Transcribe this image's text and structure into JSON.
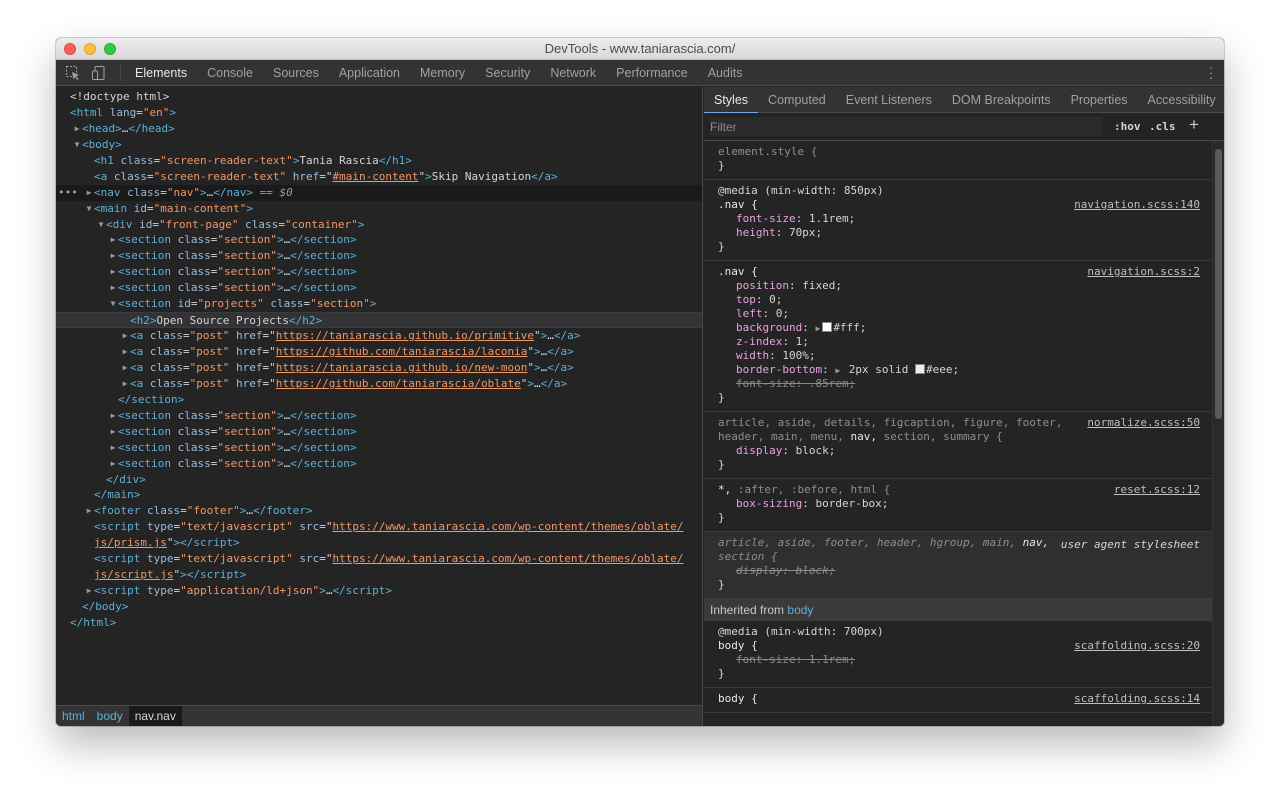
{
  "window": {
    "title": "DevTools - www.taniarascia.com/"
  },
  "toolbar": {
    "tabs": [
      "Elements",
      "Console",
      "Sources",
      "Application",
      "Memory",
      "Security",
      "Network",
      "Performance",
      "Audits"
    ],
    "active_tab": "Elements"
  },
  "dom": {
    "doctype": "<!doctype html>",
    "html_tag": "html",
    "lang_attr": "lang",
    "lang_val": "\"en\"",
    "head": "head",
    "body": "body",
    "h1_class": "\"screen-reader-text\"",
    "h1_text": "Tania Rascia",
    "a_class": "\"screen-reader-text\"",
    "a_href": "#main-content",
    "a_text": "Skip Navigation",
    "nav_class": "\"nav\"",
    "selected_suffix": " == $0",
    "main_id": "\"main-content\"",
    "div_id": "\"front-page\"",
    "div_class": "\"container\"",
    "section_class": "\"section\"",
    "projects_id": "\"projects\"",
    "h2_text": "Open Source Projects",
    "post_class": "\"post\"",
    "links": [
      "https://taniarascia.github.io/primitive",
      "https://github.com/taniarascia/laconia",
      "https://taniarascia.github.io/new-moon",
      "https://github.com/taniarascia/oblate"
    ],
    "footer_class": "\"footer\"",
    "script_type": "\"text/javascript\"",
    "script1_src_a": "https://www.taniarascia.com/wp-content/themes/oblate/",
    "script1_src_b": "js/prism.js",
    "script2_src_a": "https://www.taniarascia.com/wp-content/themes/oblate/",
    "script2_src_b": "js/script.js",
    "ldjson_type": "\"application/ld+json\"",
    "ellipsis": "…"
  },
  "breadcrumbs": [
    "html",
    "body",
    "nav.nav"
  ],
  "styles_panel": {
    "tabs": [
      "Styles",
      "Computed",
      "Event Listeners",
      "DOM Breakpoints",
      "Properties",
      "Accessibility"
    ],
    "active_tab": "Styles",
    "filter_placeholder": "Filter",
    "hov_label": ":hov",
    "cls_label": ".cls",
    "add_label": "+",
    "inherited_label": "Inherited from",
    "inherited_from": "body"
  },
  "rules": {
    "element_style": "element.style {",
    "r1_media": "@media (min-width: 850px)",
    "r1_selector": ".nav {",
    "r1_source": "navigation.scss:140",
    "r1_p1_name": "font-size",
    "r1_p1_val": "1.1rem;",
    "r1_p2_name": "height",
    "r1_p2_val": "70px;",
    "r2_selector": ".nav {",
    "r2_source": "navigation.scss:2",
    "r2_p1_name": "position",
    "r2_p1_val": "fixed;",
    "r2_p2_name": "top",
    "r2_p2_val": "0;",
    "r2_p3_name": "left",
    "r2_p3_val": "0;",
    "r2_p4_name": "background",
    "r2_p4_val": "#fff;",
    "r2_p5_name": "z-index",
    "r2_p5_val": "1;",
    "r2_p6_name": "width",
    "r2_p6_val": "100%;",
    "r2_p7_name": "border-bottom",
    "r2_p7_val_a": "2px solid",
    "r2_p7_val_b": "#eee;",
    "r2_p8": "font-size: .85rem;",
    "r3_sel_a": "article, aside, details, figcaption, figure, footer,",
    "r3_sel_b1": "header, main, menu, ",
    "r3_sel_b2": "nav,",
    "r3_sel_b3": " section, summary {",
    "r3_source": "normalize.scss:50",
    "r3_p1_name": "display",
    "r3_p1_val": "block;",
    "r4_sel_a": "*,",
    "r4_sel_b": " :after, :before, html {",
    "r4_source": "reset.scss:12",
    "r4_p1_name": "box-sizing",
    "r4_p1_val": "border-box;",
    "r5_sel_a": "article, aside, footer, header, hgroup, main, ",
    "r5_sel_b": "nav,",
    "r5_sel_c": "section {",
    "r5_label": "user agent stylesheet",
    "r5_p1": "display: block;",
    "r6_media": "@media (min-width: 700px)",
    "r6_selector": "body {",
    "r6_source": "scaffolding.scss:20",
    "r6_p1": "font-size: 1.1rem;",
    "r7_selector": "body {",
    "r7_source": "scaffolding.scss:14",
    "close_brace": "}"
  },
  "colors": {
    "swatch_fff": "#ffffff",
    "swatch_eee": "#eeeeee"
  }
}
